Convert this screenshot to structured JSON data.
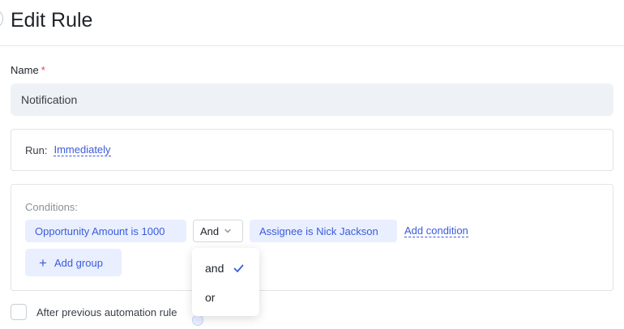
{
  "header": {
    "title": "Edit Rule"
  },
  "name_field": {
    "label": "Name",
    "required_mark": "*",
    "value": "Notification"
  },
  "run": {
    "label": "Run:",
    "value": "Immediately"
  },
  "conditions": {
    "label": "Conditions:",
    "condition_1": "Opportunity Amount is 1000",
    "operator": "And",
    "condition_2": "Assignee is Nick Jackson",
    "add_condition": "Add condition",
    "add_group": "Add group"
  },
  "operator_dropdown": {
    "options": [
      {
        "label": "and",
        "selected": true
      },
      {
        "label": "or",
        "selected": false
      }
    ]
  },
  "after_previous": {
    "label": "After previous automation rule",
    "checked": false
  },
  "colors": {
    "accent": "#3b5bdb",
    "chip_bg": "#e9efff",
    "required": "#e5484d"
  }
}
